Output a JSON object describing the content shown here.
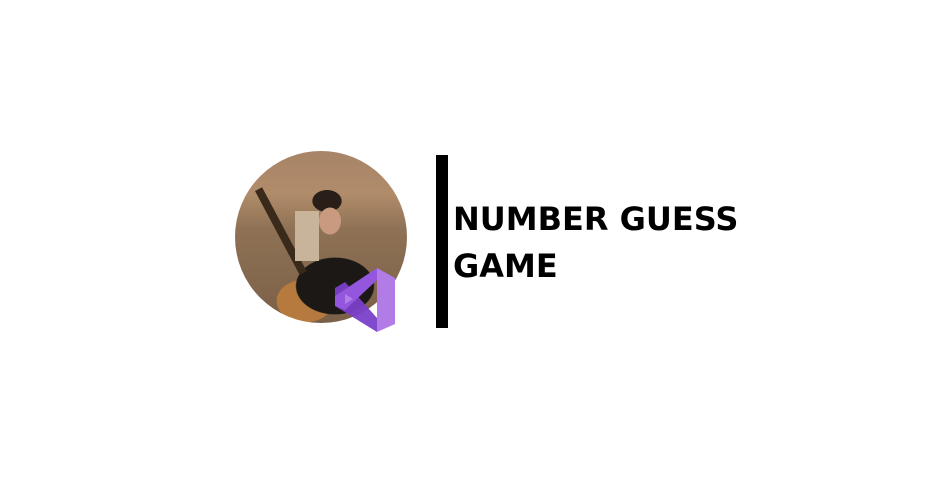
{
  "profile": {
    "photo": "profile-photo",
    "badge_icon": "visual-studio-logo-icon"
  },
  "title": {
    "line1": "NUMBER GUESS",
    "line2": "GAME"
  },
  "colors": {
    "bar": "#000000",
    "vs_purple": "#8a4fd6",
    "vs_light": "#b27ce6"
  }
}
